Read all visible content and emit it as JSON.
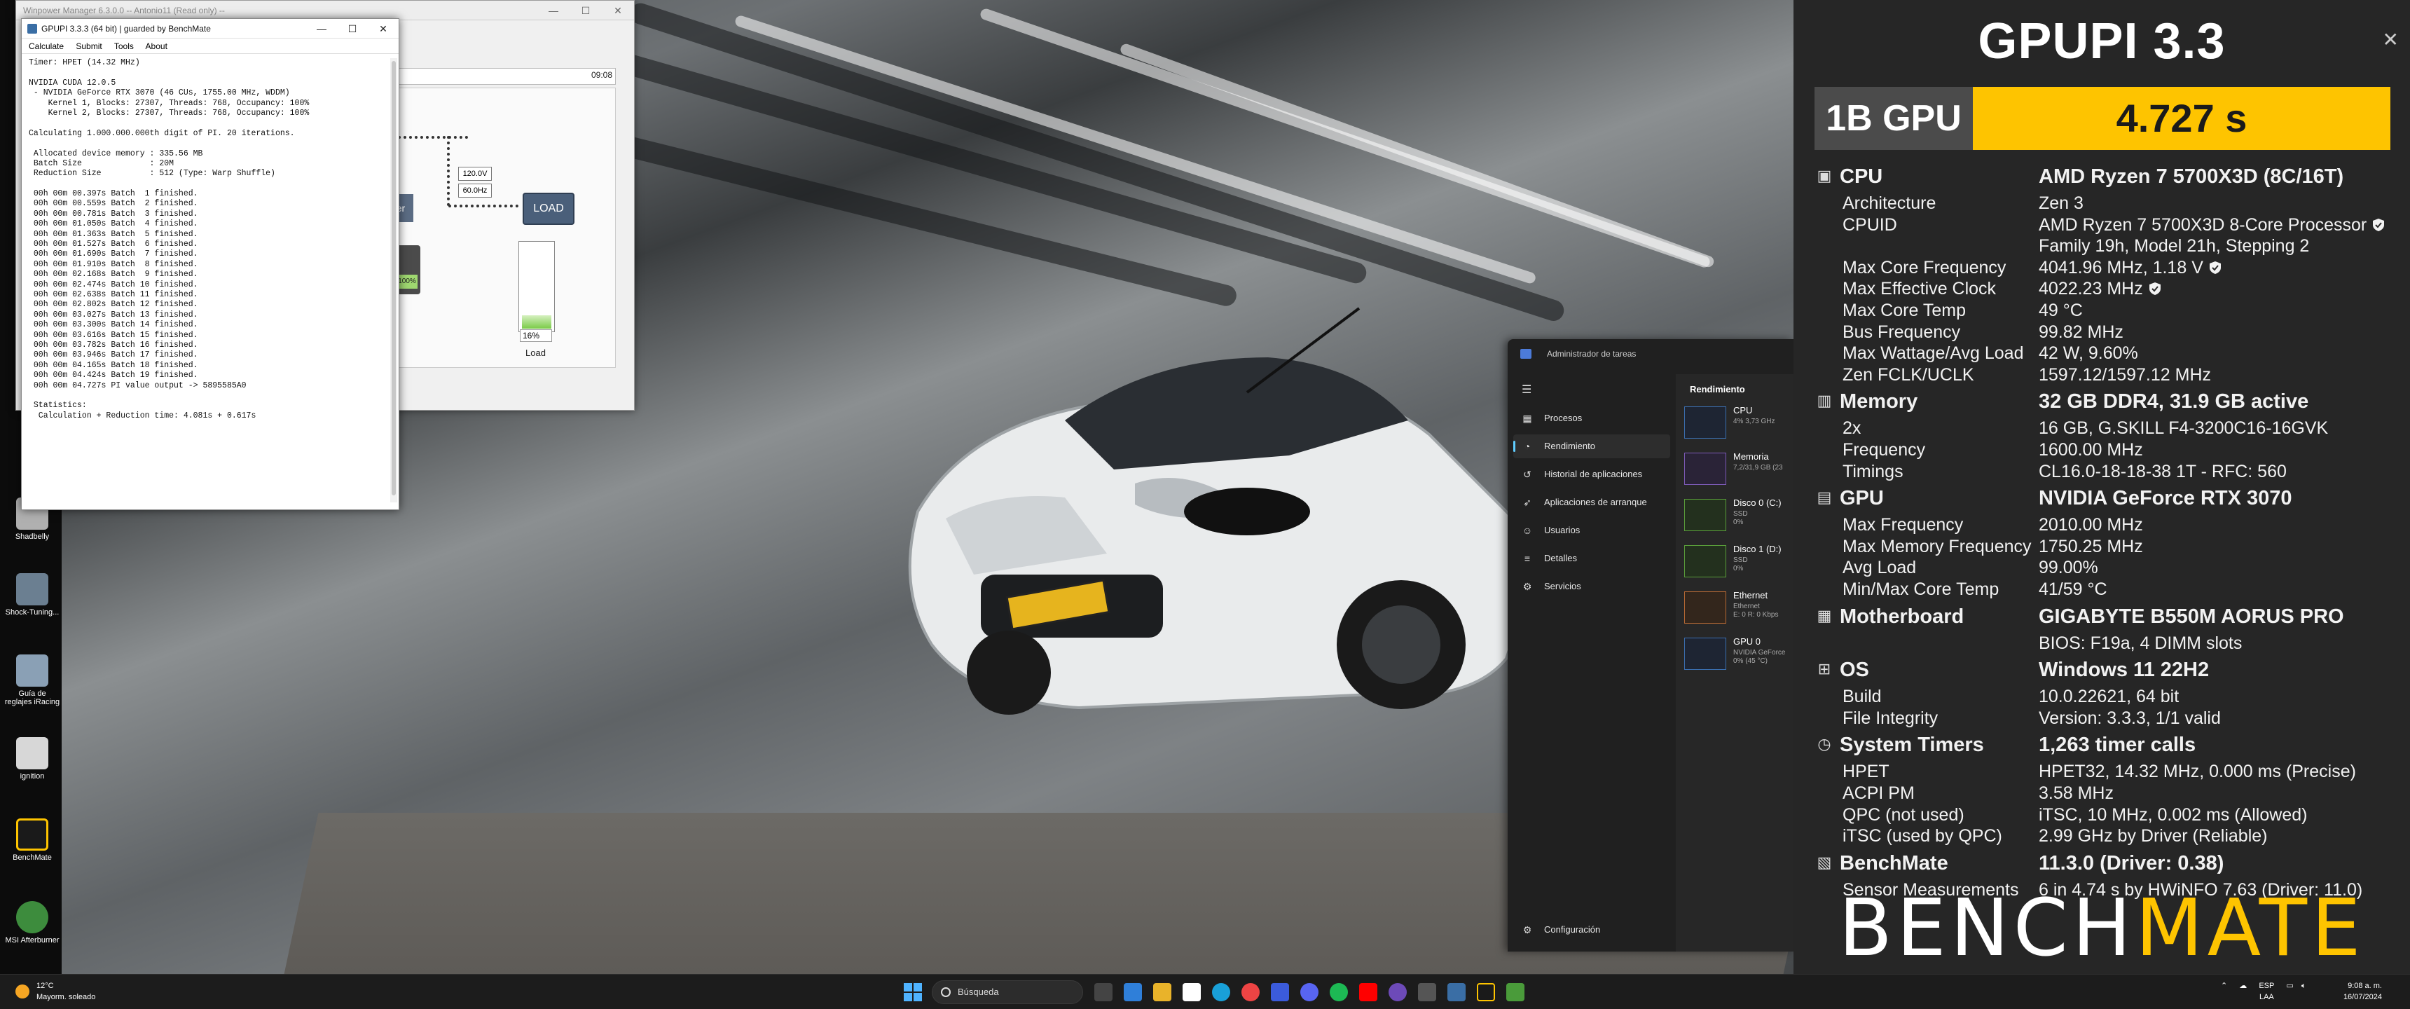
{
  "winpower": {
    "title": "Winpower Manager 6.3.0.0 -- Antonio11 (Read only) --",
    "time": "09:08",
    "tag1": "120.0V",
    "tag2": "60.0Hz",
    "load_button": "LOAD",
    "partial_button": "er",
    "battery_pct": "100%",
    "load_pct": "16%",
    "load_label": "Load",
    "load_fraction": 0.16
  },
  "gpupi": {
    "title": "GPUPI 3.3.3 (64 bit) | guarded by BenchMate",
    "menu": [
      "Calculate",
      "Submit",
      "Tools",
      "About"
    ],
    "console": [
      "Timer: HPET (14.32 MHz)",
      "",
      "NVIDIA CUDA 12.0.5",
      " - NVIDIA GeForce RTX 3070 (46 CUs, 1755.00 MHz, WDDM)",
      "    Kernel 1, Blocks: 27307, Threads: 768, Occupancy: 100%",
      "    Kernel 2, Blocks: 27307, Threads: 768, Occupancy: 100%",
      "",
      "Calculating 1.000.000.000th digit of PI. 20 iterations.",
      "",
      " Allocated device memory : 335.56 MB",
      " Batch Size              : 20M",
      " Reduction Size          : 512 (Type: Warp Shuffle)",
      "",
      " 00h 00m 00.397s Batch  1 finished.",
      " 00h 00m 00.559s Batch  2 finished.",
      " 00h 00m 00.781s Batch  3 finished.",
      " 00h 00m 01.050s Batch  4 finished.",
      " 00h 00m 01.363s Batch  5 finished.",
      " 00h 00m 01.527s Batch  6 finished.",
      " 00h 00m 01.690s Batch  7 finished.",
      " 00h 00m 01.910s Batch  8 finished.",
      " 00h 00m 02.168s Batch  9 finished.",
      " 00h 00m 02.474s Batch 10 finished.",
      " 00h 00m 02.638s Batch 11 finished.",
      " 00h 00m 02.802s Batch 12 finished.",
      " 00h 00m 03.027s Batch 13 finished.",
      " 00h 00m 03.300s Batch 14 finished.",
      " 00h 00m 03.616s Batch 15 finished.",
      " 00h 00m 03.782s Batch 16 finished.",
      " 00h 00m 03.946s Batch 17 finished.",
      " 00h 00m 04.165s Batch 18 finished.",
      " 00h 00m 04.424s Batch 19 finished.",
      " 00h 00m 04.727s PI value output -> 5895585A0",
      "",
      " Statistics:",
      "  Calculation + Reduction time: 4.081s + 0.617s"
    ]
  },
  "desktop_icons": [
    {
      "label": "Shadbelly",
      "color": "#b0b0b0"
    },
    {
      "label": "Shock-Tuning...",
      "color": "#6b7f91"
    },
    {
      "label": "Guía de reglajes iRacing",
      "color": "#8aa0b5"
    },
    {
      "label": "ignition",
      "color": "#d7d7d7"
    },
    {
      "label": "BenchMate",
      "color": "#fec400"
    },
    {
      "label": "MSI Afterburner",
      "color": "#3d8c3d"
    }
  ],
  "taskmgr": {
    "title": "Administrador de tareas",
    "section": "Rendimiento",
    "nav": [
      {
        "label": "Procesos",
        "icon": "grid-icon"
      },
      {
        "label": "Rendimiento",
        "icon": "chart-icon"
      },
      {
        "label": "Historial de aplicaciones",
        "icon": "history-icon"
      },
      {
        "label": "Aplicaciones de arranque",
        "icon": "rocket-icon"
      },
      {
        "label": "Usuarios",
        "icon": "users-icon"
      },
      {
        "label": "Detalles",
        "icon": "list-icon"
      },
      {
        "label": "Servicios",
        "icon": "puzzle-icon"
      }
    ],
    "settings": "Configuración",
    "perf": [
      {
        "name": "CPU",
        "sub": "4% 3,73 GHz"
      },
      {
        "name": "Memoria",
        "sub": "7,2/31,9 GB (23"
      },
      {
        "name": "Disco 0 (C:)",
        "sub": "SSD\n0%"
      },
      {
        "name": "Disco 1 (D:)",
        "sub": "SSD\n0%"
      },
      {
        "name": "Ethernet",
        "sub": "Ethernet\nE: 0 R: 0 Kbps"
      },
      {
        "name": "GPU 0",
        "sub": "NVIDIA GeForce\n0% (45 °C)"
      }
    ]
  },
  "benchmate": {
    "title": "GPUPI 3.3",
    "score_label": "1B GPU",
    "score_value": "4.727 s",
    "rows": [
      {
        "type": "h",
        "icon": "cpu-icon",
        "k": "CPU",
        "v": "AMD Ryzen 7 5700X3D (8C/16T)"
      },
      {
        "k": "Architecture",
        "v": "Zen 3"
      },
      {
        "k": "CPUID",
        "v": "AMD Ryzen 7 5700X3D 8-Core Processor",
        "shield": true
      },
      {
        "k": "",
        "v": "Family 19h, Model 21h, Stepping 2"
      },
      {
        "k": "Max Core Frequency",
        "v": "4041.96 MHz, 1.18 V",
        "shield": true
      },
      {
        "k": "Max Effective Clock",
        "v": "4022.23 MHz",
        "shield": true
      },
      {
        "k": "Max Core Temp",
        "v": "49 °C"
      },
      {
        "k": "Bus Frequency",
        "v": "99.82 MHz"
      },
      {
        "k": "Max Wattage/Avg Load",
        "v": "42 W, 9.60%"
      },
      {
        "k": "Zen FCLK/UCLK",
        "v": "1597.12/1597.12 MHz"
      },
      {
        "type": "h",
        "icon": "memory-icon",
        "k": "Memory",
        "v": "32 GB DDR4, 31.9 GB active"
      },
      {
        "k": "2x",
        "v": "16 GB, G.SKILL F4-3200C16-16GVK"
      },
      {
        "k": "Frequency",
        "v": "1600.00 MHz"
      },
      {
        "k": "Timings",
        "v": "CL16.0-18-18-38 1T - RFC: 560"
      },
      {
        "type": "h",
        "icon": "gpu-icon",
        "k": "GPU",
        "v": "NVIDIA GeForce RTX 3070"
      },
      {
        "k": "Max Frequency",
        "v": "2010.00 MHz"
      },
      {
        "k": "Max Memory Frequency",
        "v": "1750.25 MHz"
      },
      {
        "k": "Avg Load",
        "v": "99.00%"
      },
      {
        "k": "Min/Max Core Temp",
        "v": "41/59 °C"
      },
      {
        "type": "h",
        "icon": "motherboard-icon",
        "k": "Motherboard",
        "v": "GIGABYTE B550M AORUS PRO"
      },
      {
        "k": "",
        "v": "BIOS: F19a, 4 DIMM slots"
      },
      {
        "type": "h",
        "icon": "windows-icon",
        "k": "OS",
        "v": "Windows 11 22H2"
      },
      {
        "k": "Build",
        "v": "10.0.22621, 64 bit"
      },
      {
        "k": "File Integrity",
        "v": "Version: 3.3.3, 1/1 valid"
      },
      {
        "type": "h",
        "icon": "timer-icon",
        "k": "System Timers",
        "v": "1,263 timer calls"
      },
      {
        "k": "HPET",
        "v": "HPET32, 14.32 MHz, 0.000 ms (Precise)"
      },
      {
        "k": "ACPI PM",
        "v": "3.58 MHz"
      },
      {
        "k": "QPC (not used)",
        "v": "iTSC, 10 MHz, 0.002 ms (Allowed)"
      },
      {
        "k": "iTSC (used by QPC)",
        "v": "2.99 GHz by Driver (Reliable)"
      },
      {
        "type": "h",
        "icon": "benchmate-icon",
        "k": "BenchMate",
        "v": "11.3.0 (Driver: 0.38)"
      },
      {
        "k": "Sensor Measurements",
        "v": "6 in 4.74 s by HWiNFO 7.63 (Driver: 11.0)"
      }
    ],
    "logo_a": "BENCH",
    "logo_b": "MATE"
  },
  "taskbar": {
    "weather_temp": "12°C",
    "weather_desc": "Mayorm. soleado",
    "search_placeholder": "Búsqueda",
    "lang1": "ESP",
    "lang2": "LAA",
    "time": "9:08 a. m.",
    "date": "16/07/2024"
  }
}
